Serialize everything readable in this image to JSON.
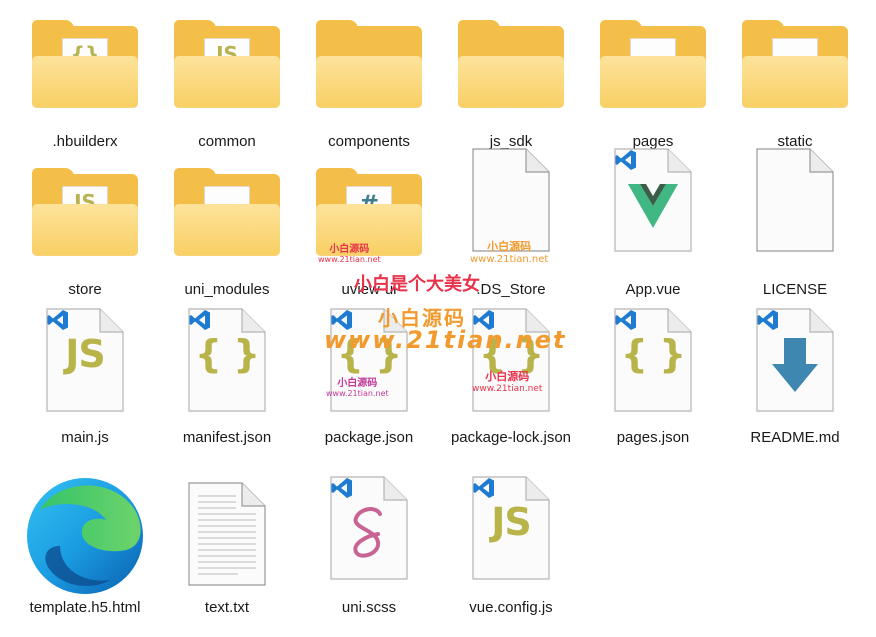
{
  "items": [
    {
      "label": ".hbuilderx",
      "icon": "folder-icon"
    },
    {
      "label": "common",
      "icon": "folder-icon"
    },
    {
      "label": "components",
      "icon": "folder-icon"
    },
    {
      "label": "js_sdk",
      "icon": "folder-icon"
    },
    {
      "label": "pages",
      "icon": "folder-icon"
    },
    {
      "label": "static",
      "icon": "folder-icon"
    },
    {
      "label": "store",
      "icon": "folder-icon"
    },
    {
      "label": "uni_modules",
      "icon": "folder-icon"
    },
    {
      "label": "uview-ui",
      "icon": "folder-icon"
    },
    {
      "label": ".DS_Store",
      "icon": "blank-file-icon"
    },
    {
      "label": "App.vue",
      "icon": "vue-file-icon"
    },
    {
      "label": "LICENSE",
      "icon": "blank-file-icon"
    },
    {
      "label": "main.js",
      "icon": "js-file-icon"
    },
    {
      "label": "manifest.json",
      "icon": "json-file-icon"
    },
    {
      "label": "package.json",
      "icon": "json-file-icon"
    },
    {
      "label": "package-lock.json",
      "icon": "json-file-icon"
    },
    {
      "label": "pages.json",
      "icon": "json-file-icon"
    },
    {
      "label": "README.md",
      "icon": "markdown-file-icon"
    },
    {
      "label": "template.h5.html",
      "icon": "edge-html-icon"
    },
    {
      "label": "text.txt",
      "icon": "text-file-icon"
    },
    {
      "label": "uni.scss",
      "icon": "sass-file-icon"
    },
    {
      "label": "vue.config.js",
      "icon": "js-file-icon"
    }
  ],
  "glyphs": {
    "hbuilderx": "{}",
    "common": "JS",
    "store": "JS",
    "uview": "#",
    "js": "JS",
    "json": "{ }"
  },
  "watermarks": {
    "main": "小白是个大美女",
    "site_cn": "小白源码",
    "site_url": "www.21tian.net"
  },
  "colors": {
    "folder": "#f4bf48",
    "folder_front": "#f8cf63",
    "vscode_blue": "#1f7ad1",
    "js_text": "#b8b44a",
    "vue_green": "#41b883",
    "vue_dark": "#3b5e4a",
    "markdown_arrow": "#3d87b0",
    "sass_pink": "#c76494",
    "watermark_red": "#e8334a",
    "watermark_orange": "#f29a2e"
  }
}
